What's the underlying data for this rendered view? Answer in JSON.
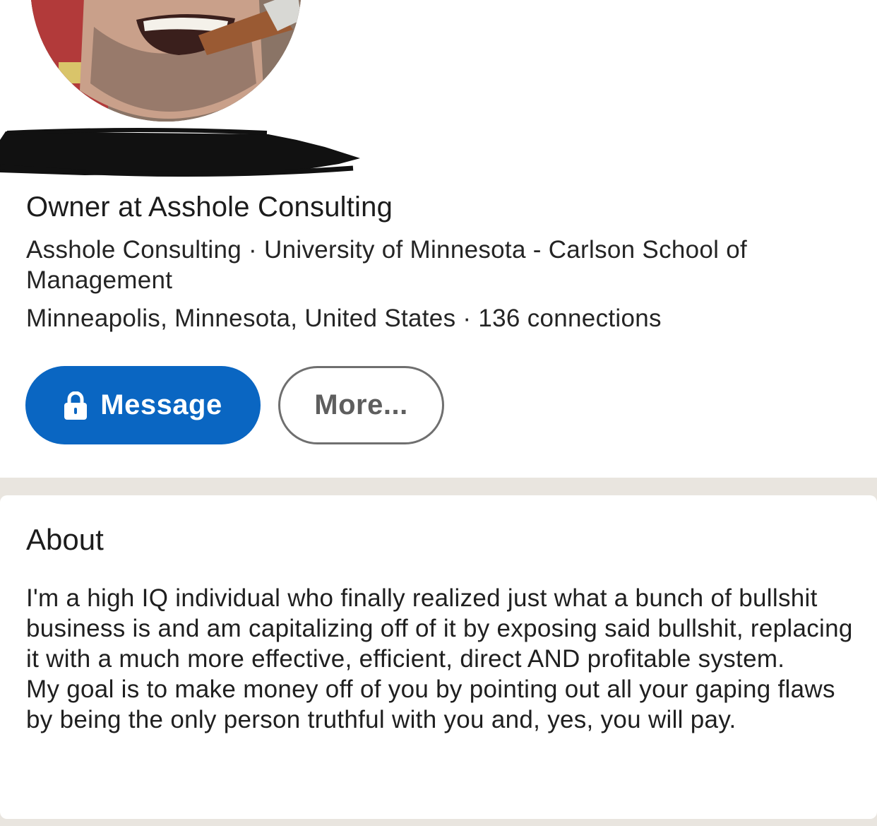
{
  "profile": {
    "headline": "Owner at Asshole Consulting",
    "company": "Asshole Consulting",
    "separator": " · ",
    "education": "University of Minnesota - Carlson School of Management",
    "location": "Minneapolis, Minnesota, United States",
    "connections": "136 connections"
  },
  "actions": {
    "message_label": "Message",
    "message_icon": "lock-icon",
    "more_label": "More..."
  },
  "about": {
    "title": "About",
    "paragraphs": [
      "I'm a high IQ individual who finally realized just what a bunch of bullshit business is and am capitalizing off of it by exposing said bullshit, replacing it with a much more effective, efficient, direct AND profitable system.",
      "My goal is to make money off of you by pointing out all your gaping flaws by being the only person truthful with you and, yes, you will pay."
    ]
  },
  "colors": {
    "primary_button": "#0a66c2",
    "page_background": "#e9e5df",
    "card_background": "#ffffff"
  }
}
